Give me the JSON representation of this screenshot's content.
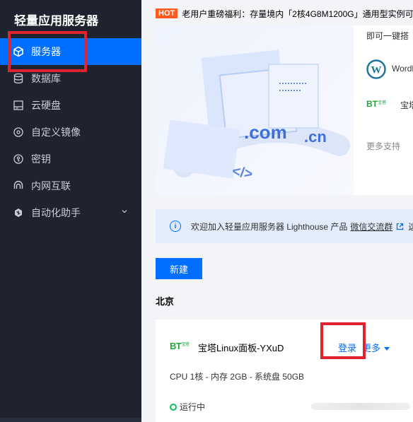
{
  "sidebar": {
    "title": "轻量应用服务器",
    "items": [
      {
        "label": "服务器",
        "icon": "cube-icon",
        "active": true
      },
      {
        "label": "数据库",
        "icon": "database-icon"
      },
      {
        "label": "云硬盘",
        "icon": "disk-icon"
      },
      {
        "label": "自定义镜像",
        "icon": "image-disc-icon"
      },
      {
        "label": "密钥",
        "icon": "key-icon"
      },
      {
        "label": "内网互联",
        "icon": "link-icon"
      },
      {
        "label": "自动化助手",
        "icon": "automation-icon",
        "expandable": true
      }
    ]
  },
  "notice": {
    "badge": "HOT",
    "text": "老用户重磅福利：存量境内「2核4G8M1200G」通用型实例可"
  },
  "banner": {
    "art_text_com": ".com",
    "art_text_cn": ".cn",
    "art_text_code": "</>",
    "side_top": "即可一键搭",
    "wordpress_label": "Wordl",
    "bt_label": "宝塔面",
    "more_support": "更多支持"
  },
  "info_bar": {
    "text": "欢迎加入轻量应用服务器 Lighthouse 产品",
    "link": "微信交流群",
    "tail": "这"
  },
  "new_button": "新建",
  "region": "北京",
  "instance": {
    "logo_text": "BT",
    "logo_sub": "宝塔",
    "name": "宝塔Linux面板-YXuD",
    "login": "登录",
    "more": "更多",
    "spec": "CPU 1核 - 内存 2GB - 系统盘 50GB",
    "status": "运行中"
  },
  "colors": {
    "sidebar_bg": "#1f2330",
    "accent": "#006eff",
    "highlight_box": "#e0242f",
    "hot_badge": "#ff5a1f",
    "running_green": "#0abf5b"
  }
}
